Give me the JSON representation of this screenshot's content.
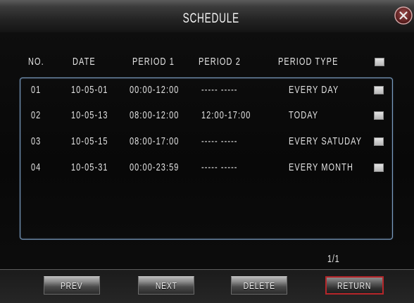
{
  "title": "SCHEDULE",
  "icons": {
    "close": "close-icon"
  },
  "table": {
    "columns": [
      "NO.",
      "DATE",
      "PERIOD 1",
      "PERIOD 2",
      "PERIOD TYPE"
    ],
    "rows": [
      {
        "no": "01",
        "date": "10-05-01",
        "period1": "00:00-12:00",
        "period2": "----- -----",
        "type": "EVERY DAY"
      },
      {
        "no": "02",
        "date": "10-05-13",
        "period1": "08:00-12:00",
        "period2": "12:00-17:00",
        "type": "TODAY"
      },
      {
        "no": "03",
        "date": "10-05-15",
        "period1": "08:00-17:00",
        "period2": "----- -----",
        "type": "EVERY SATUDAY"
      },
      {
        "no": "04",
        "date": "10-05-31",
        "period1": "00:00-23:59",
        "period2": "----- -----",
        "type": "EVERY MONTH"
      }
    ]
  },
  "pagination": {
    "indicator": "1/1"
  },
  "buttons": {
    "prev": "PREV",
    "next": "NEXT",
    "delete": "DELETE",
    "return": "RETURN"
  },
  "colors": {
    "background": "#0b0b0b",
    "text": "#e2e2e2",
    "table_border": "#7c9fc4",
    "return_border": "#b5262a",
    "checkbox": "#c8c8c8",
    "close_button": "#7a2a2a"
  }
}
